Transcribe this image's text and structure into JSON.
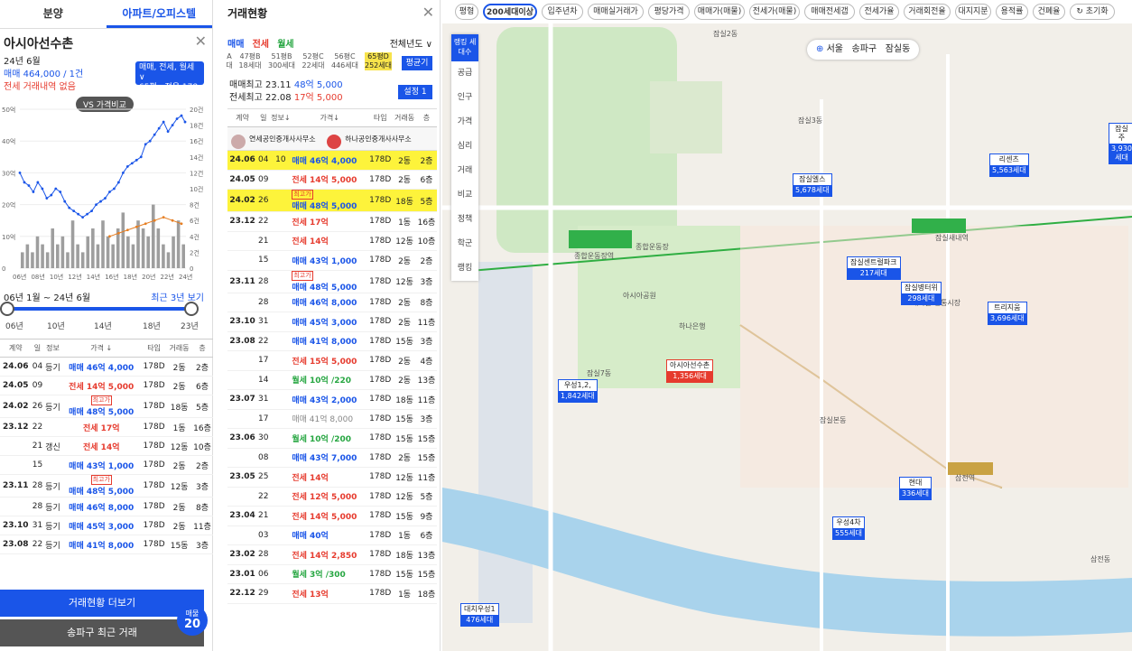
{
  "left": {
    "tabs": [
      "분양",
      "아파트/오피스텔"
    ],
    "complex_name": "아시아선수촌",
    "date": "24년 6월",
    "deal_line": "매매 464,000 / 1건",
    "jeonse_line": "전세 거래내역 없음",
    "pill": {
      "l1": "매매, 전세, 월세 ∨",
      "l2": "65평 : 전용 178㎡"
    },
    "vs_label": "VS 가격비교",
    "range_label": "06년 1월 ~ 24년 6월",
    "range_recent": "최근 3년 보기",
    "range_ticks": [
      "06년",
      "10년",
      "14년",
      "18년",
      "23년"
    ],
    "table_head": [
      "계약",
      "일",
      "정보",
      "가격 ↓",
      "타입",
      "거래동",
      "층"
    ],
    "rows": [
      [
        "24.06",
        "04",
        "등기",
        "",
        "매매 46억 4,000",
        "178D",
        "2동",
        "2층",
        "deal"
      ],
      [
        "24.05",
        "09",
        "",
        "",
        "전세 14억 5,000",
        "178D",
        "2동",
        "6층",
        "jeon"
      ],
      [
        "24.02",
        "26",
        "등기",
        "최고가",
        "매매 48억 5,000",
        "178D",
        "18동",
        "5층",
        "deal"
      ],
      [
        "23.12",
        "22",
        "",
        "",
        "전세 17억",
        "178D",
        "1동",
        "16층",
        "jeon"
      ],
      [
        "",
        "21",
        "갱신",
        "",
        "전세 14억",
        "178D",
        "12동",
        "10층",
        "jeon"
      ],
      [
        "",
        "15",
        "",
        "",
        "매매 43억 1,000",
        "178D",
        "2동",
        "2층",
        "deal"
      ],
      [
        "23.11",
        "28",
        "등기",
        "최고가",
        "매매 48억 5,000",
        "178D",
        "12동",
        "3층",
        "deal"
      ],
      [
        "",
        "28",
        "등기",
        "",
        "매매 46억 8,000",
        "178D",
        "2동",
        "8층",
        "deal"
      ],
      [
        "23.10",
        "31",
        "등기",
        "",
        "매매 45억 3,000",
        "178D",
        "2동",
        "11층",
        "deal"
      ],
      [
        "23.08",
        "22",
        "등기",
        "",
        "매매 41억 8,000",
        "178D",
        "15동",
        "3층",
        "deal"
      ]
    ],
    "more_btn": "거래현황 더보기",
    "recent_btn": "송파구 최근 거래",
    "badge": {
      "label": "매물",
      "count": "20"
    }
  },
  "chart_data": {
    "type": "line",
    "title": "",
    "xlabel": "",
    "ylabel": "",
    "x_ticks": [
      "06년",
      "08년",
      "10년",
      "12년",
      "14년",
      "16년",
      "18년",
      "20년",
      "22년",
      "24년"
    ],
    "y_left_ticks": [
      "0",
      "10억",
      "20억",
      "30억",
      "40억",
      "50억"
    ],
    "y_right_ticks": [
      "0",
      "2건",
      "4건",
      "6건",
      "8건",
      "10건",
      "12건",
      "14건",
      "16건",
      "18건",
      "20건"
    ],
    "ylim": [
      0,
      50
    ],
    "series": [
      {
        "name": "",
        "color": "#1a55e8",
        "values": [
          [
            2006,
            30
          ],
          [
            2006.5,
            27
          ],
          [
            2007,
            26
          ],
          [
            2007.5,
            24
          ],
          [
            2008,
            27
          ],
          [
            2008.5,
            25
          ],
          [
            2009,
            22
          ],
          [
            2009.5,
            23
          ],
          [
            2010,
            25
          ],
          [
            2010.5,
            24
          ],
          [
            2011,
            21
          ],
          [
            2011.5,
            19
          ],
          [
            2012,
            18
          ],
          [
            2012.5,
            17
          ],
          [
            2013,
            16
          ],
          [
            2013.5,
            17
          ],
          [
            2014,
            18
          ],
          [
            2014.5,
            20
          ],
          [
            2015,
            21
          ],
          [
            2015.5,
            22
          ],
          [
            2016,
            24
          ],
          [
            2016.5,
            25
          ],
          [
            2017,
            27
          ],
          [
            2017.5,
            30
          ],
          [
            2018,
            32
          ],
          [
            2018.5,
            33
          ],
          [
            2019,
            34
          ],
          [
            2019.5,
            35
          ],
          [
            2020,
            39
          ],
          [
            2020.5,
            40
          ],
          [
            2021,
            42
          ],
          [
            2021.5,
            44
          ],
          [
            2022,
            46
          ],
          [
            2022.5,
            43
          ],
          [
            2023,
            45
          ],
          [
            2023.5,
            47
          ],
          [
            2024,
            48
          ],
          [
            2024.4,
            46
          ]
        ]
      },
      {
        "name": "",
        "color": "#e67e22",
        "values": [
          [
            2016,
            10
          ],
          [
            2017,
            11
          ],
          [
            2018,
            12
          ],
          [
            2019,
            13
          ],
          [
            2020,
            14
          ],
          [
            2021,
            15
          ],
          [
            2022,
            16
          ],
          [
            2023,
            15
          ],
          [
            2024,
            14
          ]
        ]
      }
    ],
    "bars": {
      "color": "#9e9e9e",
      "values": [
        2,
        3,
        2,
        4,
        3,
        2,
        5,
        3,
        4,
        2,
        6,
        3,
        2,
        4,
        5,
        3,
        6,
        4,
        3,
        5,
        7,
        4,
        3,
        6,
        5,
        4,
        8,
        5,
        3,
        2,
        4,
        6,
        3
      ]
    }
  },
  "mid": {
    "title": "거래현황",
    "filters": [
      "매매",
      "전세",
      "월세"
    ],
    "year_sel": "전체년도 ∨",
    "sizes": [
      {
        "top": "A",
        "bot": "대"
      },
      {
        "top": "47평B",
        "bot": "18세대"
      },
      {
        "top": "51평B",
        "bot": "300세대"
      },
      {
        "top": "52평C",
        "bot": "22세대"
      },
      {
        "top": "56평C",
        "bot": "446세대"
      },
      {
        "top": "65평D",
        "bot": "252세대"
      }
    ],
    "compare_btn": "평균기",
    "max_deal": {
      "label": "매매최고",
      "date": "23.11",
      "price": "48억 5,000"
    },
    "max_jeonse": {
      "label": "전세최고",
      "date": "22.08",
      "price": "17억 5,000"
    },
    "settings_btn": "설정 1",
    "agents": [
      "연세공인중개사사무소",
      "하나공인중개사사무소"
    ],
    "table_head": [
      "계약",
      "일",
      "정보↓",
      "가격↓",
      "타입",
      "거래동",
      "층"
    ],
    "rows": [
      [
        "24.06",
        "04",
        "10",
        "",
        "매매 46억 4,000",
        "178D",
        "2동",
        "2층",
        "deal",
        "hl"
      ],
      [
        "24.05",
        "09",
        "",
        "",
        "전세 14억 5,000",
        "178D",
        "2동",
        "6층",
        "jeon",
        ""
      ],
      [
        "24.02",
        "26",
        "",
        "최고가",
        "매매 48억 5,000",
        "178D",
        "18동",
        "5층",
        "deal",
        "hl"
      ],
      [
        "23.12",
        "22",
        "",
        "",
        "전세 17억",
        "178D",
        "1동",
        "16층",
        "jeon",
        ""
      ],
      [
        "",
        "21",
        "",
        "",
        "전세 14억",
        "178D",
        "12동",
        "10층",
        "jeon",
        ""
      ],
      [
        "",
        "15",
        "",
        "",
        "매매 43억 1,000",
        "178D",
        "2동",
        "2층",
        "deal",
        ""
      ],
      [
        "23.11",
        "28",
        "",
        "최고가",
        "매매 48억 5,000",
        "178D",
        "12동",
        "3층",
        "deal",
        ""
      ],
      [
        "",
        "28",
        "",
        "",
        "매매 46억 8,000",
        "178D",
        "2동",
        "8층",
        "deal",
        ""
      ],
      [
        "23.10",
        "31",
        "",
        "",
        "매매 45억 3,000",
        "178D",
        "2동",
        "11층",
        "deal",
        ""
      ],
      [
        "23.08",
        "22",
        "",
        "",
        "매매 41억 8,000",
        "178D",
        "15동",
        "3층",
        "deal",
        ""
      ],
      [
        "",
        "17",
        "",
        "",
        "전세 15억 5,000",
        "178D",
        "2동",
        "4층",
        "jeon",
        ""
      ],
      [
        "",
        "14",
        "",
        "",
        "월세 10억 /220",
        "178D",
        "2동",
        "13층",
        "wol",
        ""
      ],
      [
        "23.07",
        "31",
        "",
        "",
        "매매 43억 2,000",
        "178D",
        "18동",
        "11층",
        "deal",
        ""
      ],
      [
        "",
        "17",
        "",
        "",
        "매매 41억 8,000",
        "178D",
        "15동",
        "3층",
        "grey",
        ""
      ],
      [
        "23.06",
        "30",
        "",
        "",
        "월세 10억 /200",
        "178D",
        "15동",
        "15층",
        "wol",
        ""
      ],
      [
        "",
        "08",
        "",
        "",
        "매매 43억 7,000",
        "178D",
        "2동",
        "15층",
        "deal",
        ""
      ],
      [
        "23.05",
        "25",
        "",
        "",
        "전세 14억",
        "178D",
        "12동",
        "11층",
        "jeon",
        ""
      ],
      [
        "",
        "22",
        "",
        "",
        "전세 12억 5,000",
        "178D",
        "12동",
        "5층",
        "jeon",
        ""
      ],
      [
        "23.04",
        "21",
        "",
        "",
        "전세 14억 5,000",
        "178D",
        "15동",
        "9층",
        "jeon",
        ""
      ],
      [
        "",
        "03",
        "",
        "",
        "매매 40억",
        "178D",
        "1동",
        "6층",
        "deal",
        ""
      ],
      [
        "23.02",
        "28",
        "",
        "",
        "전세 14억 2,850",
        "178D",
        "18동",
        "13층",
        "jeon",
        ""
      ],
      [
        "23.01",
        "06",
        "",
        "",
        "월세 3억 /300",
        "178D",
        "15동",
        "15층",
        "wol",
        ""
      ],
      [
        "22.12",
        "29",
        "",
        "",
        "전세 13억",
        "178D",
        "1동",
        "18층",
        "jeon",
        ""
      ]
    ]
  },
  "map": {
    "chips": [
      "평형",
      "200세대이상",
      "입주년차",
      "매매실거래가",
      "평당가격",
      "매매가(매물)",
      "전세가(매물)",
      "매매전세갭",
      "전세가율",
      "거래회전율",
      "대지지분",
      "용적률",
      "건폐율",
      "↻ 초기화"
    ],
    "side": [
      "랭킹 세대수",
      "공급",
      "인구",
      "가격",
      "심리",
      "거래",
      "비교",
      "정책",
      "학군",
      "랭킹"
    ],
    "breadcrumb": [
      "서울",
      "송파구",
      "잠실동"
    ],
    "markers": [
      {
        "name": "잠실엘스",
        "units": "5,678세대",
        "red": false
      },
      {
        "name": "리센츠",
        "units": "5,563세대",
        "red": false
      },
      {
        "name": "잠실센트럴파크",
        "units": "217세대",
        "red": false
      },
      {
        "name": "잠실병터위",
        "units": "298세대",
        "red": false
      },
      {
        "name": "트리지움",
        "units": "3,696세대",
        "red": false
      },
      {
        "name": "아시아선수촌",
        "units": "1,356세대",
        "red": true
      },
      {
        "name": "우성1,2,",
        "units": "1,842세대",
        "red": false
      },
      {
        "name": "현대",
        "units": "336세대",
        "red": false
      },
      {
        "name": "우성4차",
        "units": "555세대",
        "red": false
      },
      {
        "name": "대치우성1",
        "units": "476세대",
        "red": false
      },
      {
        "name": "잠실주",
        "units": "3,930세대",
        "red": false
      }
    ],
    "labels": [
      "잠실2동",
      "종합운동장역",
      "잠실새내역",
      "삼전역",
      "새마을 전통시장",
      "아시아공원",
      "잠실7동",
      "잠실본동",
      "하나은행",
      "종합운동장",
      "삼전동",
      "잠실3동"
    ]
  }
}
